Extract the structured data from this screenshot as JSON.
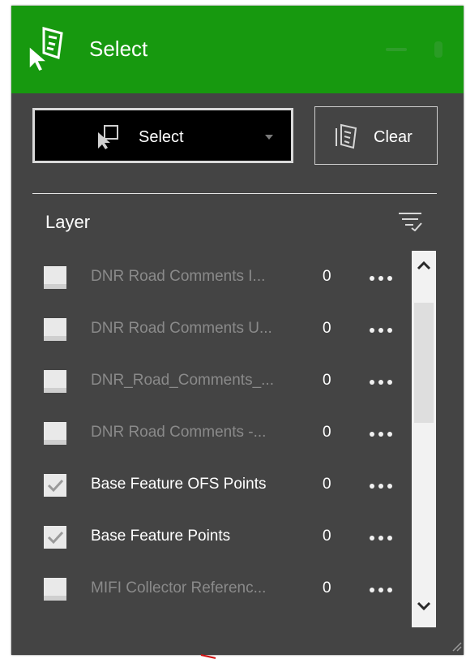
{
  "header": {
    "title": "Select",
    "icon": "select-widget-icon",
    "accent_color": "#17990f"
  },
  "toolbar": {
    "select_label": "Select",
    "select_icon": "select-rectangle-icon",
    "clear_label": "Clear",
    "clear_icon": "clear-selection-icon"
  },
  "layers": {
    "header": "Layer",
    "items": [
      {
        "name": "DNR Road Comments I...",
        "count": "0",
        "checked": false
      },
      {
        "name": "DNR Road Comments U...",
        "count": "0",
        "checked": false
      },
      {
        "name": "DNR_Road_Comments_...",
        "count": "0",
        "checked": false
      },
      {
        "name": "DNR Road Comments -...",
        "count": "0",
        "checked": false
      },
      {
        "name": "Base Feature OFS Points",
        "count": "0",
        "checked": true
      },
      {
        "name": "Base Feature Points",
        "count": "0",
        "checked": true
      },
      {
        "name": "MIFI Collector Referenc...",
        "count": "0",
        "checked": false
      }
    ]
  }
}
